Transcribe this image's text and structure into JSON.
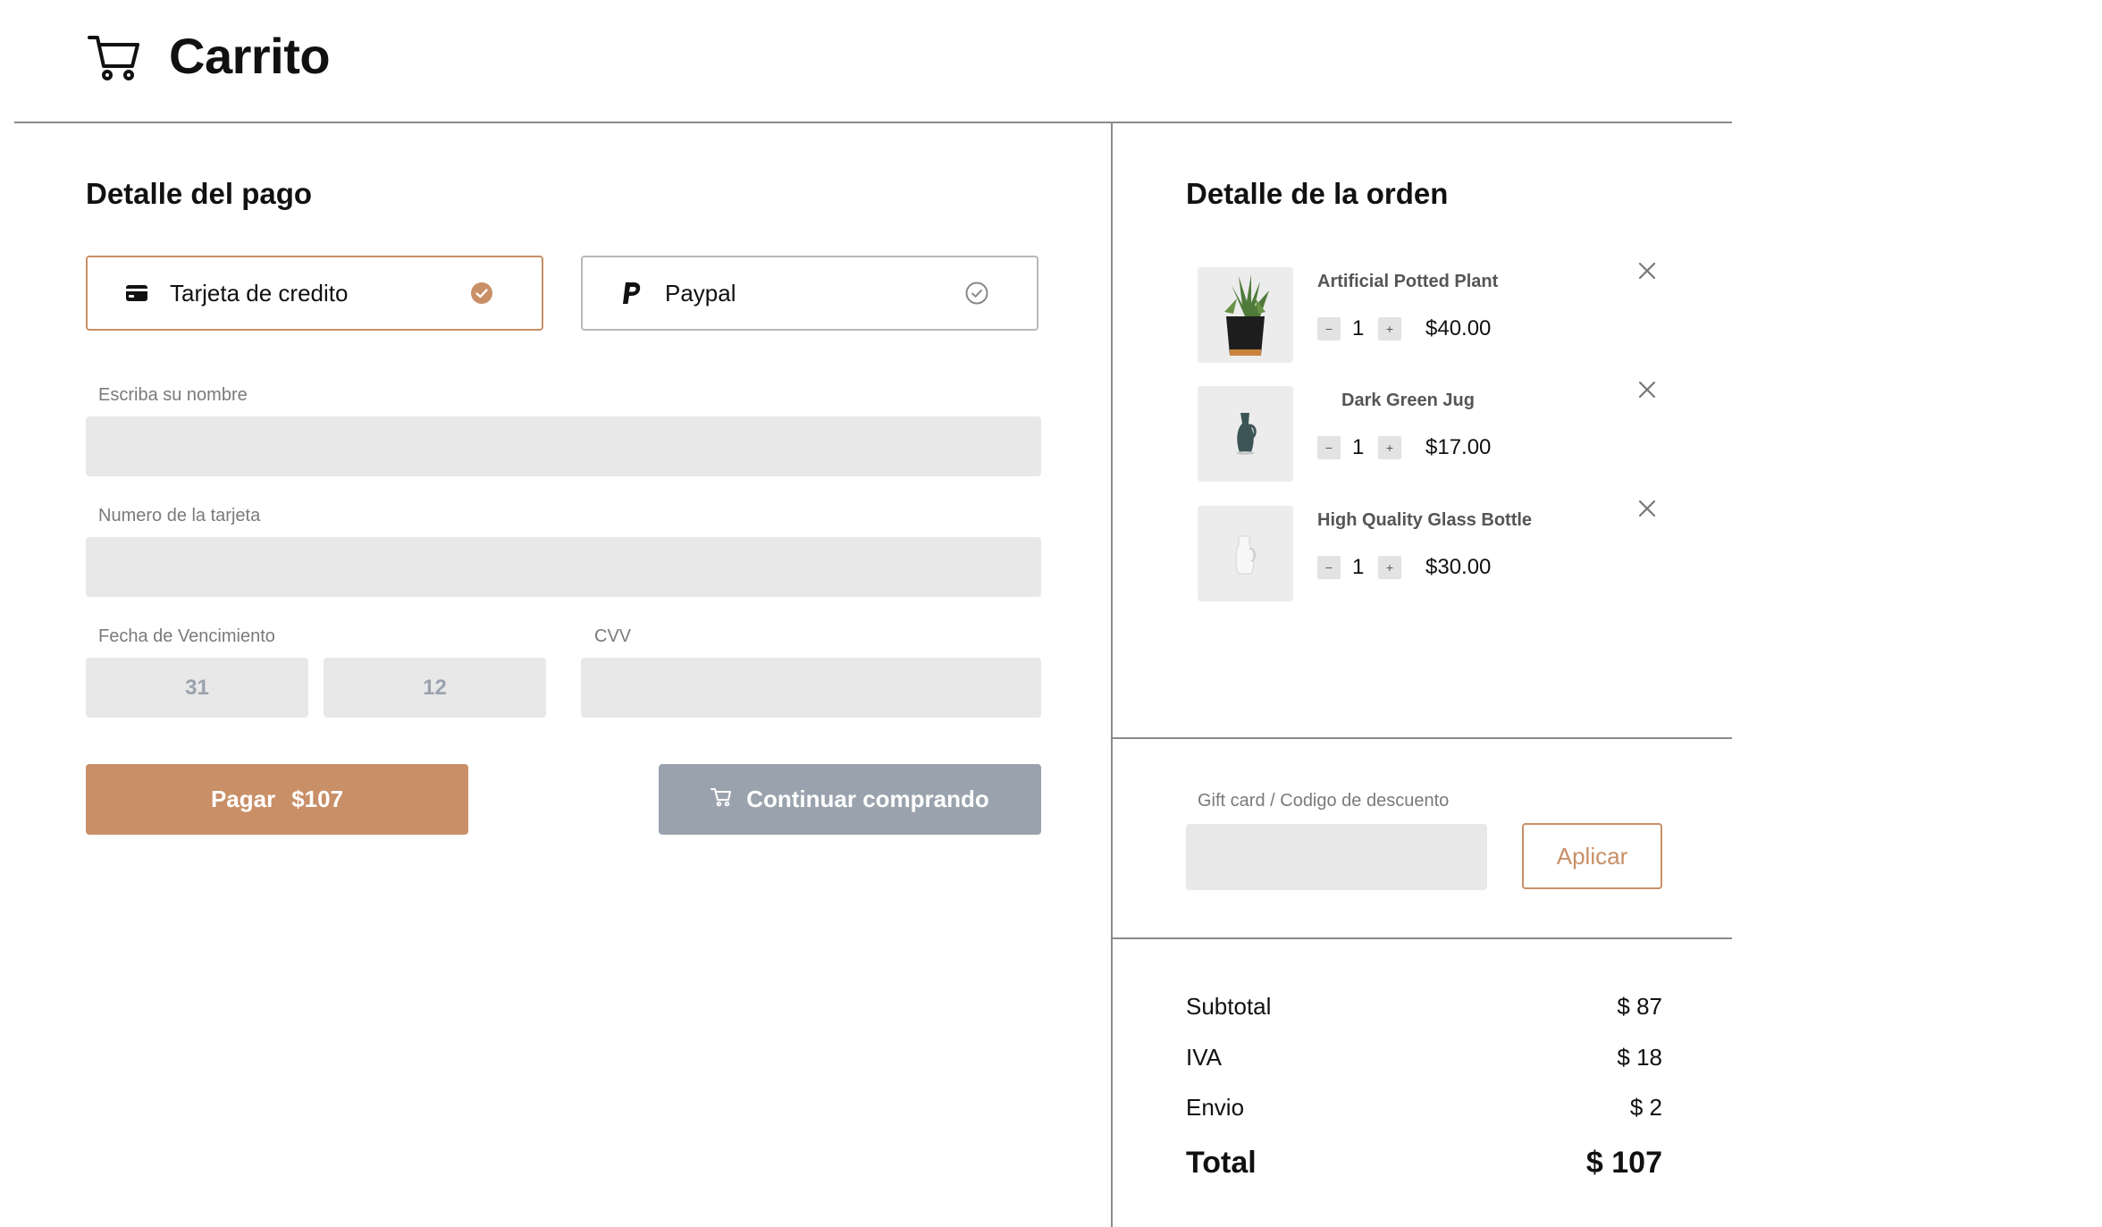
{
  "header": {
    "title": "Carrito",
    "icon": "cart-icon"
  },
  "payment": {
    "title": "Detalle del pago",
    "options": [
      {
        "label": "Tarjeta de credito",
        "icon": "credit-card-icon",
        "selected": true
      },
      {
        "label": "Paypal",
        "icon": "paypal-icon",
        "selected": false
      }
    ],
    "name_label": "Escriba su nombre",
    "name_value": "",
    "card_label": "Numero de la tarjeta",
    "card_value": "",
    "expiry_label": "Fecha de Vencimiento",
    "expiry_day": "31",
    "expiry_month": "12",
    "cvv_label": "CVV",
    "cvv_value": "",
    "pay_label": "Pagar",
    "pay_amount": "$107",
    "continue_label": "Continuar comprando"
  },
  "order": {
    "title": "Detalle de la orden",
    "items": [
      {
        "name": "Artificial Potted Plant",
        "qty": "1",
        "price": "$40.00"
      },
      {
        "name": "Dark Green Jug",
        "qty": "1",
        "price": "$17.00"
      },
      {
        "name": "High Quality Glass Bottle",
        "qty": "1",
        "price": "$30.00"
      }
    ],
    "decrement_symbol": "−",
    "increment_symbol": "+",
    "discount_label": "Gift card / Codigo de descuento",
    "discount_value": "",
    "apply_label": "Aplicar"
  },
  "summary": {
    "subtotal_label": "Subtotal",
    "subtotal_value": "$ 87",
    "iva_label": "IVA",
    "iva_value": "$ 18",
    "shipping_label": "Envio",
    "shipping_value": "$ 2",
    "total_label": "Total",
    "total_value": "$ 107"
  },
  "colors": {
    "accent": "#c98f67",
    "muted": "#9aa3ad",
    "input_bg": "#e8e8e8",
    "divider": "#8a8a8a"
  }
}
